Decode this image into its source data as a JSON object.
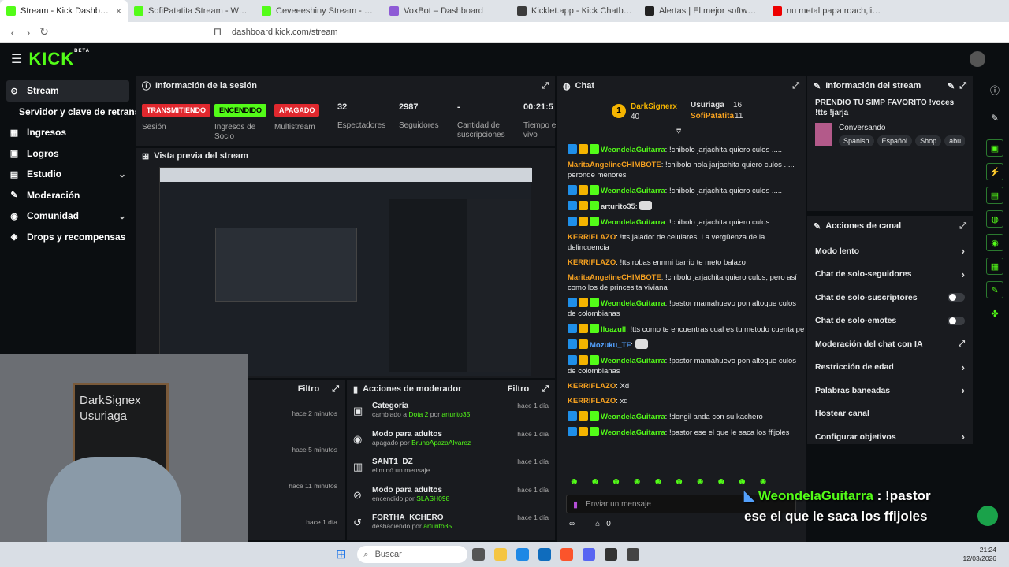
{
  "browser": {
    "tabs": [
      {
        "title": "Stream - Kick Dashboard",
        "color": "#53fc18",
        "active": true
      },
      {
        "title": "SofiPatatita Stream - Watch Live",
        "color": "#53fc18"
      },
      {
        "title": "Ceveeeshiny Stream - Watch Live",
        "color": "#53fc18"
      },
      {
        "title": "VoxBot – Dashboard",
        "color": "#8e5bd6"
      },
      {
        "title": "Kicklet.app - Kick Chatbot and Overl",
        "color": "#3c3c3c"
      },
      {
        "title": "Alertas | El mejor software para pote",
        "color": "#222"
      },
      {
        "title": "nu metal papa roach,limp bizkit",
        "color": "#e00"
      }
    ],
    "url": "dashboard.kick.com/stream"
  },
  "brand": {
    "logo": "KICK",
    "beta": "BETA",
    "accent": "#53fc18"
  },
  "sidebar": {
    "items": [
      {
        "label": "Stream",
        "icon": "stream-icon",
        "active": true
      },
      {
        "label": "Servidor y clave de retransmisión",
        "sub": true
      },
      {
        "label": "Ingresos",
        "icon": "money-icon"
      },
      {
        "label": "Logros",
        "icon": "trophy-icon"
      },
      {
        "label": "Estudio",
        "icon": "studio-icon",
        "chev": "⌄"
      },
      {
        "label": "Moderación",
        "icon": "wrench-icon"
      },
      {
        "label": "Comunidad",
        "icon": "people-icon",
        "chev": "⌄"
      },
      {
        "label": "Drops y recompensas",
        "icon": "gift-icon"
      }
    ]
  },
  "session": {
    "title": "Información de la sesión",
    "stats": [
      {
        "value": "TRANSMITIENDO",
        "label": "Sesión",
        "badge": "#e0282e"
      },
      {
        "value": "ENCENDIDO",
        "label": "Ingresos de Socio",
        "badge": "#53fc18"
      },
      {
        "value": "APAGADO",
        "label": "Multistream",
        "badge": "#e0282e"
      },
      {
        "value": "32",
        "label": "Espectadores"
      },
      {
        "value": "2987",
        "label": "Seguidores"
      },
      {
        "value": "-",
        "label": "Cantidad de suscripciones"
      },
      {
        "value": "00:21:5",
        "label": "Tiempo en vivo"
      }
    ]
  },
  "preview": {
    "title": "Vista previa del stream"
  },
  "overlay": {
    "sign_line1": "DarkSignex",
    "sign_line2": "Usuriaga"
  },
  "activity": {
    "filter": "Filtro",
    "times": [
      "hace 2 minutos",
      "hace 5 minutos",
      "hace 11 minutos",
      "hace 1 día"
    ]
  },
  "modactions": {
    "title": "Acciones de moderador",
    "filter": "Filtro",
    "rows": [
      {
        "title": "Categoría",
        "desc": "cambiado a",
        "target": "Dota 2",
        "by": "por",
        "user": "arturito35",
        "time": "hace 1 día",
        "icon": "category-icon"
      },
      {
        "title": "Modo para adultos",
        "desc": "apagado por",
        "target": "",
        "by": "",
        "user": "BrunoApazaAlvarez",
        "time": "hace 1 día",
        "icon": "eye-icon"
      },
      {
        "title": "SANT1_DZ",
        "desc": "eliminó un mensaje",
        "target": "",
        "by": "",
        "user": "",
        "time": "hace 1 día",
        "icon": "trash-icon"
      },
      {
        "title": "Modo para adultos",
        "desc": "encendido por",
        "target": "",
        "by": "",
        "user": "SLASH098",
        "time": "hace 1 día",
        "icon": "eye-off-icon"
      },
      {
        "title": "FORTHA_KCHERO",
        "desc": "deshaciendo por",
        "target": "",
        "by": "",
        "user": "arturito35",
        "time": "hace 1 día",
        "icon": "undo-icon"
      }
    ]
  },
  "chat": {
    "title": "Chat",
    "top": [
      {
        "name": "DarkSignerx",
        "count": "40",
        "rank": "1"
      },
      {
        "name": "Usuriaga",
        "count": "16"
      },
      {
        "name": "SofiPatatita",
        "count": "11"
      }
    ],
    "messages": [
      {
        "user": "WeondelaGuitarra",
        "color": "#53fc18",
        "text": "!chibolo jarjachita quiero culos .....",
        "badges": 3
      },
      {
        "user": "MaritaAngelineCHIMBOTE",
        "color": "#f4a020",
        "text": "!chibolo hola jarjachita quiero culos ..... peronde menores",
        "badges": 0
      },
      {
        "user": "WeondelaGuitarra",
        "color": "#53fc18",
        "text": "!chibolo jarjachita quiero culos .....",
        "badges": 3
      },
      {
        "user": "arturito35",
        "color": "#ddd",
        "text": "",
        "badges": 3
      },
      {
        "user": "WeondelaGuitarra",
        "color": "#53fc18",
        "text": "!chibolo jarjachita quiero culos .....",
        "badges": 3
      },
      {
        "user": "KERRIFLAZO",
        "color": "#f4a020",
        "text": "!tts jalador de celulares. La vergüenza de la delincuencia",
        "badges": 0
      },
      {
        "user": "KERRIFLAZO",
        "color": "#f4a020",
        "text": "!tts robas ennmi barrio te meto balazo",
        "badges": 0
      },
      {
        "user": "MaritaAngelineCHIMBOTE",
        "color": "#f4a020",
        "text": "!chibolo jarjachita quiero culos, pero así como los de princesita viviana",
        "badges": 0
      },
      {
        "user": "WeondelaGuitarra",
        "color": "#53fc18",
        "text": "!pastor mamahuevo pon altoque culos de colombianas",
        "badges": 3
      },
      {
        "user": "lloazull",
        "color": "#53fc18",
        "text": "!tts como te encuentras cual es tu metodo cuenta pe",
        "badges": 3
      },
      {
        "user": "Mozuku_TF",
        "color": "#53a0fc",
        "text": "",
        "badges": 2
      },
      {
        "user": "WeondelaGuitarra",
        "color": "#53fc18",
        "text": "!pastor mamahuevo pon altoque culos de colombianas",
        "badges": 3
      },
      {
        "user": "KERRIFLAZO",
        "color": "#f4a020",
        "text": "Xd",
        "badges": 0
      },
      {
        "user": "KERRIFLAZO",
        "color": "#f4a020",
        "text": "xd",
        "badges": 0
      },
      {
        "user": "WeondelaGuitarra",
        "color": "#53fc18",
        "text": "!dongil anda con su kachero",
        "badges": 3
      },
      {
        "user": "WeondelaGuitarra",
        "color": "#53fc18",
        "text": "!pastor ese el que le saca los ffijoles",
        "badges": 3
      }
    ],
    "placeholder": "Enviar un mensaje",
    "viewers": "0"
  },
  "streaminfo": {
    "title": "Información del stream",
    "stream_title": "PRENDIO TU SIMP FAVORITO !voces !tts !jarja",
    "category": "Conversando",
    "tags": [
      "Spanish",
      "Español",
      "Shop",
      "abu"
    ]
  },
  "channel": {
    "title": "Acciones de canal",
    "items": [
      {
        "label": "Modo lento",
        "kind": "chev"
      },
      {
        "label": "Chat de solo-seguidores",
        "kind": "chev"
      },
      {
        "label": "Chat de solo-suscriptores",
        "kind": "toggle"
      },
      {
        "label": "Chat de solo-emotes",
        "kind": "toggle"
      },
      {
        "label": "Moderación del chat con IA",
        "kind": "ext"
      },
      {
        "label": "Restricción de edad",
        "kind": "chev"
      },
      {
        "label": "Palabras baneadas",
        "kind": "chev"
      },
      {
        "label": "Hostear canal",
        "kind": "none"
      },
      {
        "label": "Configurar objetivos",
        "kind": "chev"
      }
    ]
  },
  "tts_overlay": {
    "user": "WeondelaGuitarra",
    "line1": ": !pastor",
    "line2": "ese el que le saca los ffijoles"
  },
  "taskbar": {
    "search": "Buscar",
    "time": "21:24",
    "date": "12/03/2026"
  }
}
